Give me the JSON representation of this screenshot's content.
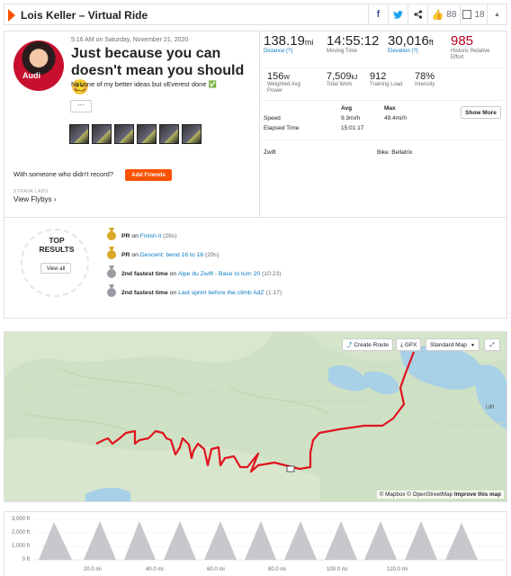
{
  "header": {
    "title": "Lois Keller – Virtual Ride",
    "kudos_count": "88",
    "comments_count": "18"
  },
  "activity": {
    "date": "5:16 AM on Saturday, November 21, 2020",
    "headline": "Just because you can doesn't mean you should 🥴",
    "description": "Not one of my better ideas but vEverest done ✅",
    "more_label": "···",
    "avatar_text": "Audi"
  },
  "social": {
    "with_someone": "With someone who didn't record?",
    "add_friends": "Add Friends",
    "labs_label": "STRAVA LABS",
    "view_flybys": "View Flybys ›"
  },
  "stats": {
    "distance": {
      "value": "138.19",
      "unit": "mi",
      "label": "Distance (?)"
    },
    "moving_time": {
      "value": "14:55:12",
      "label": "Moving Time"
    },
    "elevation": {
      "value": "30,016",
      "unit": "ft",
      "label": "Elevation (?)"
    },
    "relative_effort": {
      "value": "985",
      "label": "Historic Relative Effort"
    },
    "power": {
      "value": "156",
      "unit": "W",
      "label": "Weighted Avg Power"
    },
    "work": {
      "value": "7,509",
      "unit": "kJ",
      "label": "Total Work"
    },
    "training_load": {
      "value": "912",
      "label": "Training Load"
    },
    "intensity": {
      "value": "78%",
      "label": "Intensity"
    },
    "table": {
      "avg_header": "Avg",
      "max_header": "Max",
      "speed_label": "Speed",
      "speed_avg": "9.3mi/h",
      "speed_max": "49.4mi/h",
      "elapsed_label": "Elapsed Time",
      "elapsed_value": "15:01:17"
    },
    "show_more": "Show More",
    "device": "Zwift",
    "bike": "Bike: Bellatrix"
  },
  "results": {
    "title_line1": "TOP",
    "title_line2": "RESULTS",
    "view_all": "View all",
    "items": [
      {
        "rank": "PR",
        "prefix": " on ",
        "segment": "Finish it",
        "time": " (28s)",
        "medal": "gold"
      },
      {
        "rank": "PR",
        "prefix": " on ",
        "segment": "Descent: bend 16 to 18",
        "time": " (29s)",
        "medal": "gold"
      },
      {
        "rank": "2nd fastest time",
        "prefix": " on ",
        "segment": "Alpe du Zwift - Base to turn 20",
        "time": " (10:23)",
        "medal": "silver"
      },
      {
        "rank": "2nd fastest time",
        "prefix": " on ",
        "segment": "Last sprint before the climb AdZ",
        "time": " (1:17)",
        "medal": "silver"
      }
    ]
  },
  "map": {
    "create_route": "Create Route",
    "gpx": "GPX",
    "standard_map": "Standard Map",
    "attribution_prefix": "© Mapbox © OpenStreetMap ",
    "attribution_link": "Improve this map",
    "place_label": "Ulll",
    "route_color": "#e0141e"
  },
  "elevation_chart": {
    "y_ticks": [
      "3,000 ft",
      "2,000 ft",
      "1,000 ft",
      "0 ft"
    ],
    "x_ticks": [
      "20.0 mi",
      "40.0 mi",
      "60.0 mi",
      "80.0 mi",
      "100.0 mi",
      "120.0 mi"
    ]
  },
  "colors": {
    "brand": "#fc5200",
    "link": "#0a7bc1",
    "relative_effort": "#b3001e"
  }
}
